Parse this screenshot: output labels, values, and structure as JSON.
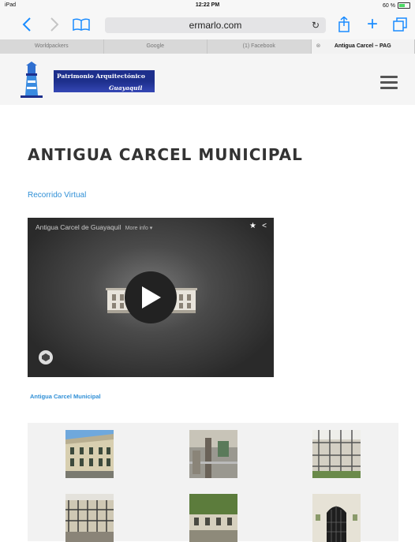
{
  "status_bar": {
    "device": "iPad",
    "time": "12:22 PM",
    "battery": "60 %"
  },
  "browser": {
    "url": "ermarlo.com",
    "tabs": [
      {
        "label": "Worldpackers",
        "active": false
      },
      {
        "label": "Google",
        "active": false
      },
      {
        "label": "(1) Facebook",
        "active": false
      },
      {
        "label": "Antigua Carcel – PAG",
        "active": true
      }
    ]
  },
  "logo": {
    "line1": "Patrimonio Arquitectónico",
    "line2": "Guayaquil"
  },
  "page": {
    "title": "ANTIGUA CARCEL MUNICIPAL",
    "tour_link": "Recorrido Virtual",
    "video_title": "Antigua Carcel de Guayaquil",
    "video_more": "More info ▾",
    "caption": "Antigua Carcel Municipal"
  },
  "colors": {
    "link": "#2f8fd6",
    "ios_blue": "#1a8cff",
    "logo_blue": "#1d2f8c"
  },
  "icons": [
    "back-icon",
    "forward-icon",
    "bookmarks-icon",
    "reload-icon",
    "share-icon",
    "add-tab-icon",
    "tabs-icon",
    "hamburger-menu-icon",
    "play-icon",
    "star-icon",
    "share-icon",
    "viewer-logo-icon"
  ]
}
